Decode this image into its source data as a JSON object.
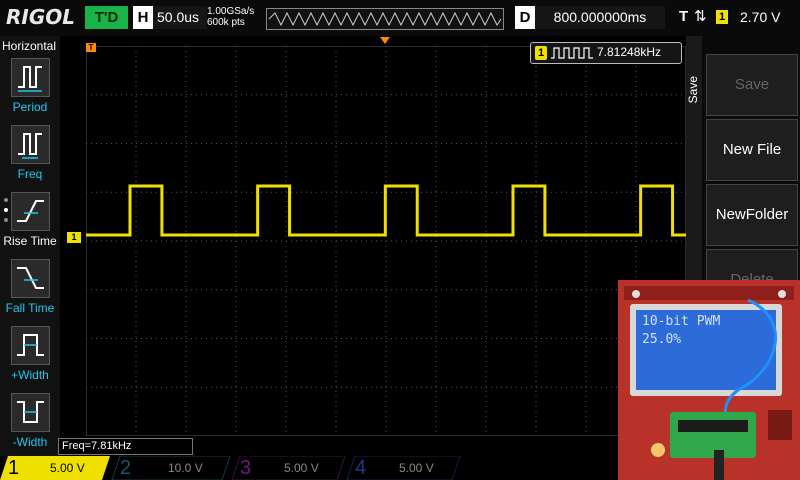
{
  "brand": "RIGOL",
  "status": "T'D",
  "timebase": {
    "key": "H",
    "value": "50.0us"
  },
  "sample": {
    "rate": "1.00GSa/s",
    "depth": "600k pts"
  },
  "delay": {
    "key": "D",
    "value": "800.000000ms"
  },
  "trigger": {
    "key": "T",
    "channel": "1",
    "level": "2.70 V"
  },
  "left_menu": {
    "title": "Horizontal",
    "items": [
      {
        "label": "Period",
        "icon": "period-icon"
      },
      {
        "label": "Freq",
        "icon": "freq-icon"
      },
      {
        "label": "Rise Time",
        "icon": "rise-time-icon"
      },
      {
        "label": "Fall Time",
        "icon": "fall-time-icon"
      },
      {
        "label": "+Width",
        "icon": "positive-width-icon"
      },
      {
        "label": "-Width",
        "icon": "negative-width-icon"
      }
    ]
  },
  "freq_display": {
    "channel": "1",
    "value": "7.81248kHz"
  },
  "measurement": "Freq=7.81kHz",
  "right_menu": {
    "title": "Save",
    "buttons": [
      {
        "label": "Save",
        "disabled": true
      },
      {
        "label": "New File",
        "disabled": false
      },
      {
        "label": "NewFolder",
        "disabled": false
      },
      {
        "label": "Delete",
        "disabled": true
      }
    ]
  },
  "channels": [
    {
      "num": "1",
      "scale": "5.00 V",
      "color": "#f0e000",
      "active": true
    },
    {
      "num": "2",
      "scale": "10.0 V",
      "color": "#1ec8f0",
      "active": false
    },
    {
      "num": "3",
      "scale": "5.00 V",
      "color": "#d020d0",
      "active": false
    },
    {
      "num": "4",
      "scale": "5.00 V",
      "color": "#2a6cf0",
      "active": false
    }
  ],
  "photo_lcd": {
    "line1": "10-bit PWM",
    "line2": "25.0%"
  },
  "waveform": {
    "periods_on_screen": 4.7,
    "duty_cycle": 0.25,
    "color": "#f0e000"
  }
}
